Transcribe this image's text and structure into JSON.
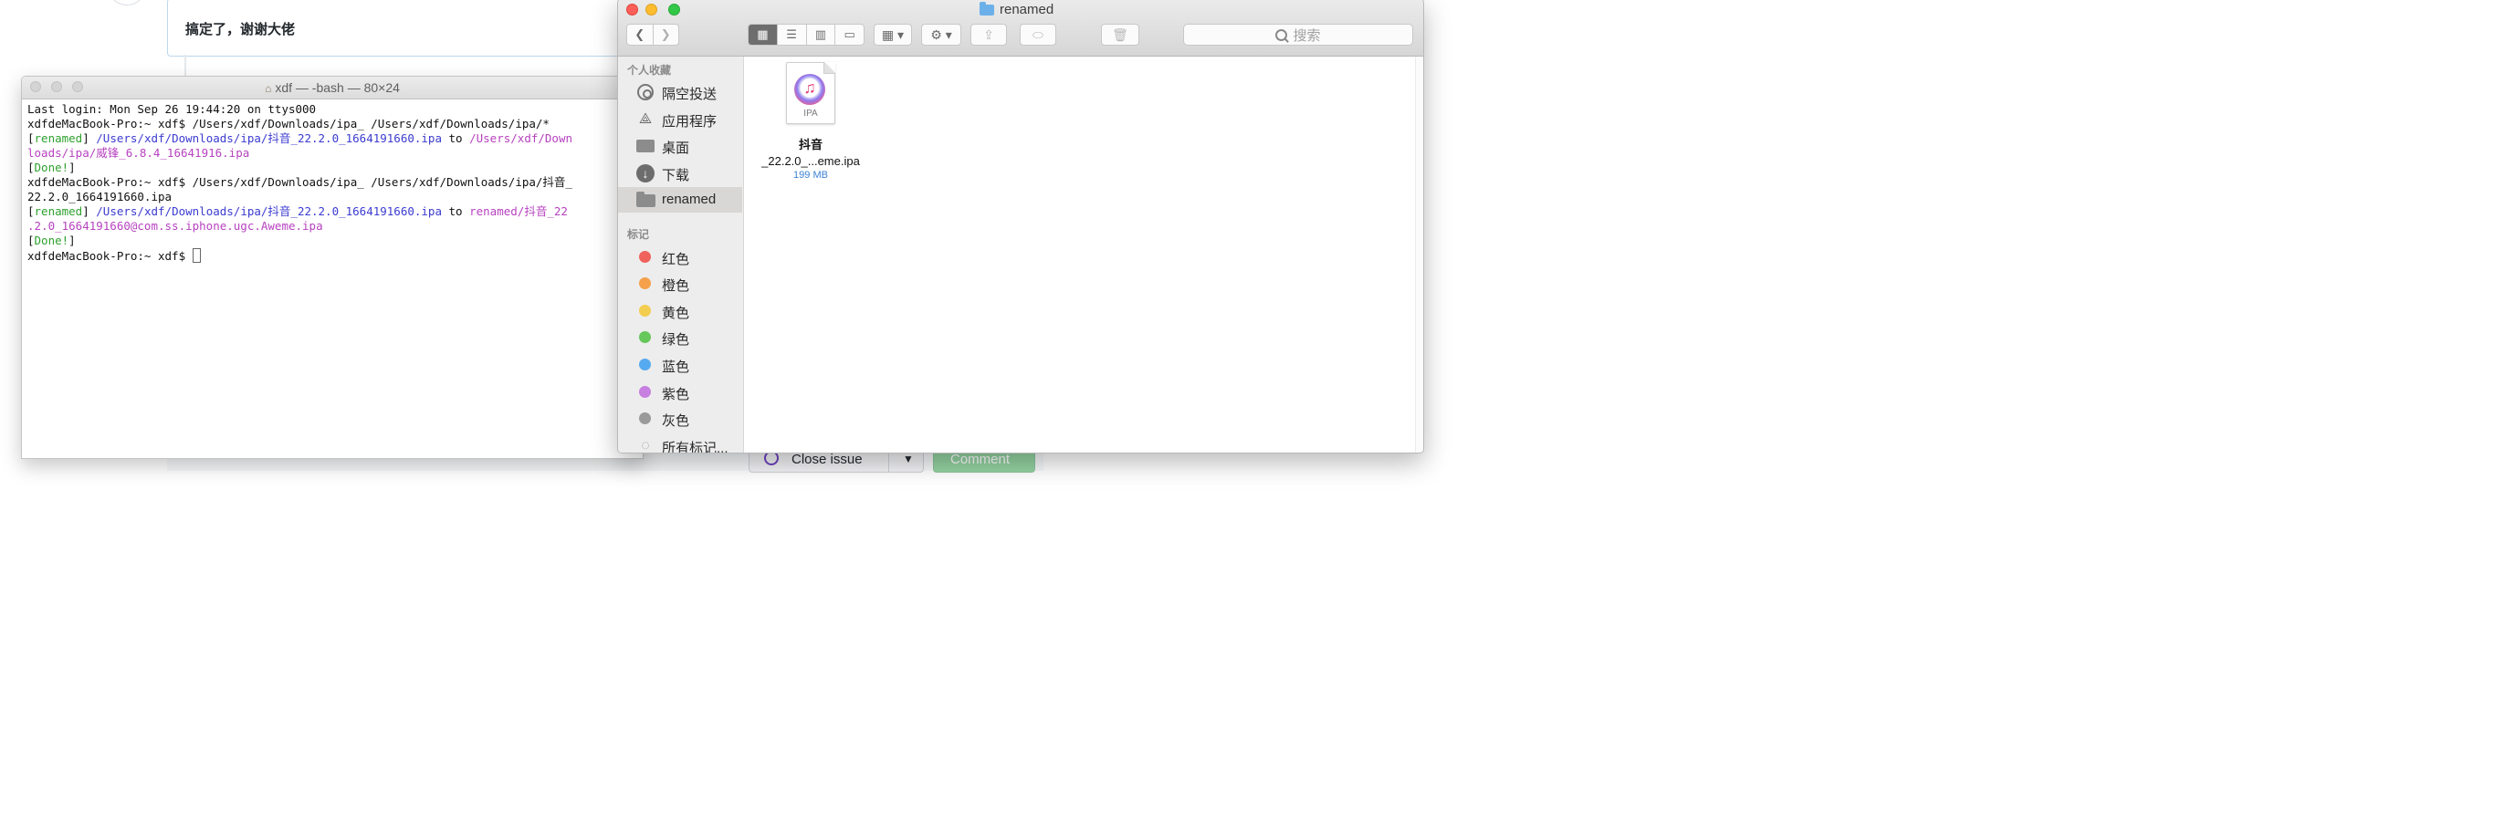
{
  "background": {
    "comment_text": "搞定了，谢谢大佬",
    "close_issue_label": "Close issue",
    "comment_button_label": "Comment"
  },
  "terminal": {
    "title": "xdf — -bash — 80×24",
    "lines": [
      [
        {
          "t": "Last login: Mon Sep 26 19:44:20 on ttys000",
          "c": ""
        }
      ],
      [
        {
          "t": "xdfdeMacBook-Pro:~ xdf$ /Users/xdf/Downloads/ipa_ /Users/xdf/Downloads/ipa/*",
          "c": ""
        }
      ],
      [
        {
          "t": "[",
          "c": ""
        },
        {
          "t": "renamed",
          "c": "c-green"
        },
        {
          "t": "] ",
          "c": ""
        },
        {
          "t": "/Users/xdf/Downloads/ipa/抖音_22.2.0_1664191660.ipa",
          "c": "c-blue"
        },
        {
          "t": " to ",
          "c": ""
        },
        {
          "t": "/Users/xdf/Down",
          "c": "c-mag"
        }
      ],
      [
        {
          "t": "loads/ipa/威锋_6.8.4_16641916.ipa",
          "c": "c-mag"
        }
      ],
      [
        {
          "t": "[",
          "c": ""
        },
        {
          "t": "Done!",
          "c": "c-green"
        },
        {
          "t": "]",
          "c": ""
        }
      ],
      [
        {
          "t": "xdfdeMacBook-Pro:~ xdf$ /Users/xdf/Downloads/ipa_ /Users/xdf/Downloads/ipa/抖音_",
          "c": ""
        }
      ],
      [
        {
          "t": "22.2.0_1664191660.ipa",
          "c": ""
        }
      ],
      [
        {
          "t": "[",
          "c": ""
        },
        {
          "t": "renamed",
          "c": "c-green"
        },
        {
          "t": "] ",
          "c": ""
        },
        {
          "t": "/Users/xdf/Downloads/ipa/抖音_22.2.0_1664191660.ipa",
          "c": "c-blue"
        },
        {
          "t": " to ",
          "c": ""
        },
        {
          "t": "renamed/抖音_22",
          "c": "c-mag"
        }
      ],
      [
        {
          "t": ".2.0_1664191660@com.ss.iphone.ugc.Aweme.ipa",
          "c": "c-mag"
        }
      ],
      [
        {
          "t": "[",
          "c": ""
        },
        {
          "t": "Done!",
          "c": "c-green"
        },
        {
          "t": "]",
          "c": ""
        }
      ],
      [
        {
          "t": "xdfdeMacBook-Pro:~ xdf$ ",
          "c": ""
        }
      ]
    ]
  },
  "finder": {
    "title": "renamed",
    "search_placeholder": "搜索",
    "sidebar": {
      "favorites_header": "个人收藏",
      "favorites": [
        {
          "label": "隔空投送",
          "icon": "airdrop-icon"
        },
        {
          "label": "应用程序",
          "icon": "applications-icon"
        },
        {
          "label": "桌面",
          "icon": "desktop-icon"
        },
        {
          "label": "下载",
          "icon": "downloads-icon"
        },
        {
          "label": "renamed",
          "icon": "folder-icon",
          "selected": true
        }
      ],
      "tags_header": "标记",
      "tags": [
        {
          "label": "红色",
          "color": "#f0625c"
        },
        {
          "label": "橙色",
          "color": "#f5a04a"
        },
        {
          "label": "黄色",
          "color": "#f3cd50"
        },
        {
          "label": "绿色",
          "color": "#66c75a"
        },
        {
          "label": "蓝色",
          "color": "#56aaf0"
        },
        {
          "label": "紫色",
          "color": "#c77fe0"
        },
        {
          "label": "灰色",
          "color": "#9a9a9a"
        }
      ],
      "all_tags_label": "所有标记..."
    },
    "files": [
      {
        "name_line1": "抖音",
        "name_line2": "_22.2.0_...eme.ipa",
        "size": "199 MB",
        "icon_label": "IPA"
      }
    ]
  }
}
